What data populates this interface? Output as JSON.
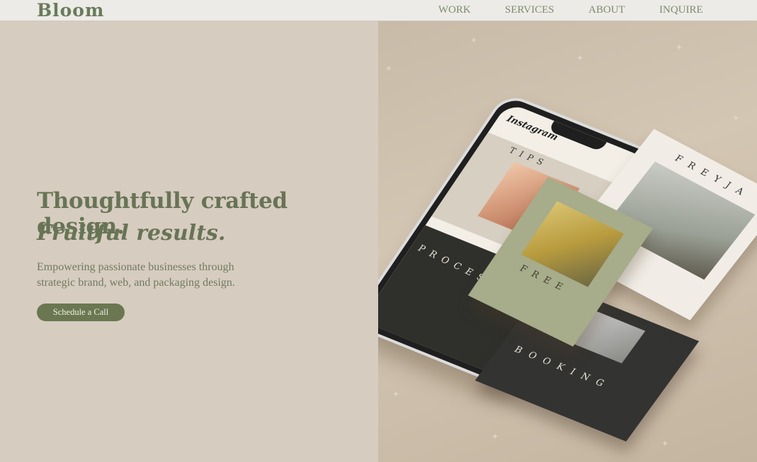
{
  "brand": {
    "logo_text": "Bloom"
  },
  "nav": {
    "items": [
      {
        "label": "WORK"
      },
      {
        "label": "SERVICES"
      },
      {
        "label": "ABOUT"
      },
      {
        "label": "INQUIRE"
      }
    ]
  },
  "hero": {
    "headline": "Thoughtfully crafted design.",
    "headline_italic": "Fruitful results.",
    "subtext": "Empowering passionate businesses through strategic brand, web, and packaging design.",
    "cta_label": "Schedule a Call"
  },
  "mockup": {
    "app_name": "Instagram",
    "post_word_1": "TIPS",
    "post_word_2": "PROCESS",
    "card_freyja": "FREYJA",
    "card_free": "FREE",
    "card_booking": "BOOKING"
  },
  "colors": {
    "accent_green": "#6a7750",
    "heading_green": "#677455",
    "background": "#d7ccc0",
    "topbar": "#ecebe7"
  }
}
